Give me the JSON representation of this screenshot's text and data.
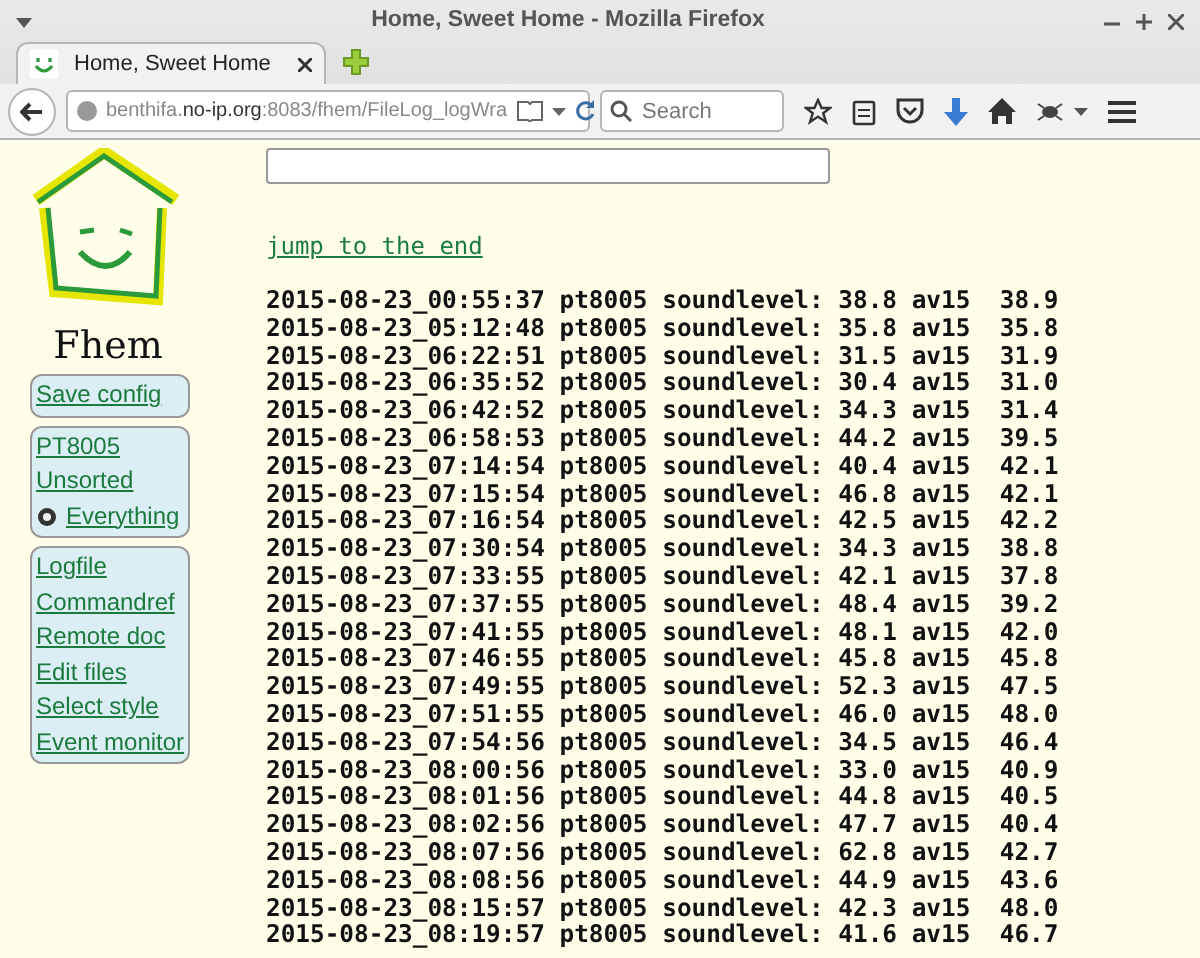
{
  "window": {
    "title": "Home, Sweet Home - Mozilla Firefox"
  },
  "tabs": [
    {
      "label": "Home, Sweet Home",
      "selected": true
    }
  ],
  "address_bar": {
    "url": "benthifa.**no-ip.org**:8083/fhem/FileLog_logWra"
  },
  "search": {
    "placeholder": "Search"
  },
  "logo": {
    "text": "Fhem"
  },
  "menu_groups": [
    [
      {
        "label": "Save config",
        "kind": "link"
      }
    ],
    [
      {
        "label": "PT8005",
        "kind": "link"
      },
      {
        "label": "Unsorted",
        "kind": "link"
      },
      {
        "label": "Everything",
        "kind": "icon_link"
      }
    ],
    [
      {
        "label": "Logfile",
        "kind": "link"
      },
      {
        "label": "Commandref",
        "kind": "link"
      },
      {
        "label": "Remote doc",
        "kind": "link"
      },
      {
        "label": "Edit files",
        "kind": "link"
      },
      {
        "label": "Select style",
        "kind": "link"
      },
      {
        "label": "Event monitor",
        "kind": "link"
      }
    ]
  ],
  "jump_link": "jump to the end",
  "log_lines": [
    "2015-08-23_00:55:37 pt8005 soundlevel: 38.8 av15  38.9",
    "2015-08-23_05:12:48 pt8005 soundlevel: 35.8 av15  35.8",
    "2015-08-23_06:22:51 pt8005 soundlevel: 31.5 av15  31.9",
    "2015-08-23_06:35:52 pt8005 soundlevel: 30.4 av15  31.0",
    "2015-08-23_06:42:52 pt8005 soundlevel: 34.3 av15  31.4",
    "2015-08-23_06:58:53 pt8005 soundlevel: 44.2 av15  39.5",
    "2015-08-23_07:14:54 pt8005 soundlevel: 40.4 av15  42.1",
    "2015-08-23_07:15:54 pt8005 soundlevel: 46.8 av15  42.1",
    "2015-08-23_07:16:54 pt8005 soundlevel: 42.5 av15  42.2",
    "2015-08-23_07:30:54 pt8005 soundlevel: 34.3 av15  38.8",
    "2015-08-23_07:33:55 pt8005 soundlevel: 42.1 av15  37.8",
    "2015-08-23_07:37:55 pt8005 soundlevel: 48.4 av15  39.2",
    "2015-08-23_07:41:55 pt8005 soundlevel: 48.1 av15  42.0",
    "2015-08-23_07:46:55 pt8005 soundlevel: 45.8 av15  45.8",
    "2015-08-23_07:49:55 pt8005 soundlevel: 52.3 av15  47.5",
    "2015-08-23_07:51:55 pt8005 soundlevel: 46.0 av15  48.0",
    "2015-08-23_07:54:56 pt8005 soundlevel: 34.5 av15  46.4",
    "2015-08-23_08:00:56 pt8005 soundlevel: 33.0 av15  40.9",
    "2015-08-23_08:01:56 pt8005 soundlevel: 44.8 av15  40.5",
    "2015-08-23_08:02:56 pt8005 soundlevel: 47.7 av15  40.4",
    "2015-08-23_08:07:56 pt8005 soundlevel: 62.8 av15  42.7",
    "2015-08-23_08:08:56 pt8005 soundlevel: 44.9 av15  43.6",
    "2015-08-23_08:15:57 pt8005 soundlevel: 42.3 av15  48.0",
    "2015-08-23_08:19:57 pt8005 soundlevel: 41.6 av15  46.7"
  ]
}
